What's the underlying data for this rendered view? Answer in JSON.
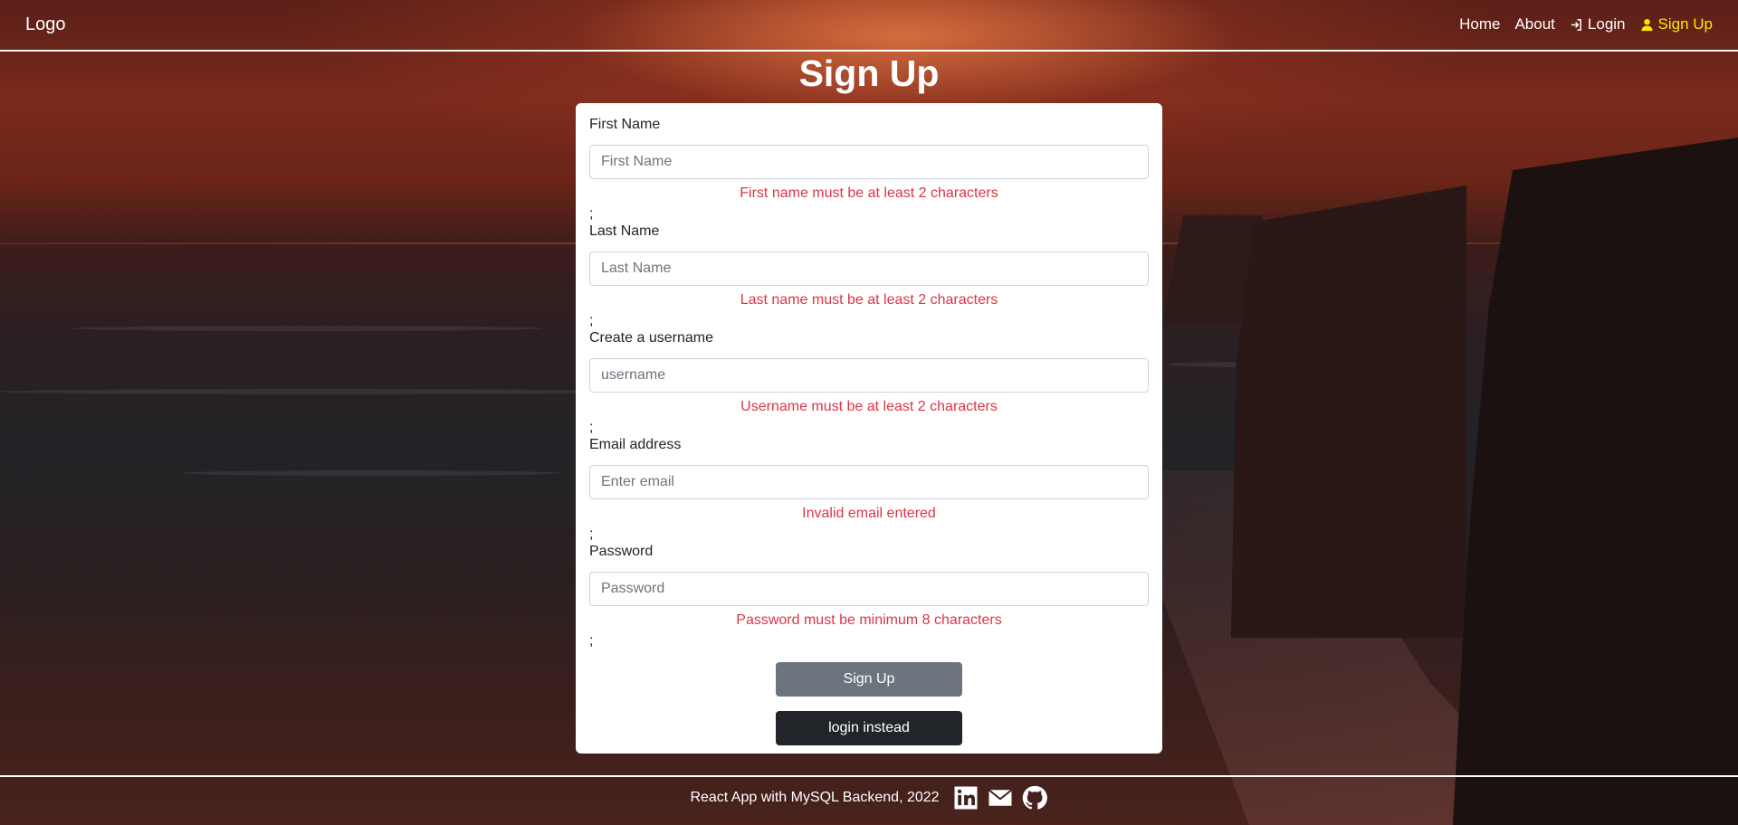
{
  "navbar": {
    "logo": "Logo",
    "links": [
      {
        "label": "Home"
      },
      {
        "label": "About"
      },
      {
        "label": "Login",
        "icon": "login-icon"
      },
      {
        "label": "Sign Up",
        "icon": "user-icon",
        "active": true
      }
    ],
    "active_color": "#ffe600"
  },
  "page_title": "Sign Up",
  "form": {
    "fields": [
      {
        "label": "First Name",
        "placeholder": "First Name",
        "value": "",
        "error": "First name must be at least 2 characters",
        "separator": ";"
      },
      {
        "label": "Last Name",
        "placeholder": "Last Name",
        "value": "",
        "error": "Last name must be at least 2 characters",
        "separator": ";"
      },
      {
        "label": "Create a username",
        "placeholder": "username",
        "value": "",
        "error": "Username must be at least 2 characters",
        "separator": ";"
      },
      {
        "label": "Email address",
        "placeholder": "Enter email",
        "value": "",
        "error": "Invalid email entered",
        "separator": ";"
      },
      {
        "label": "Password",
        "placeholder": "Password",
        "value": "",
        "error": "Password must be minimum 8 characters",
        "separator": ";"
      }
    ],
    "submit_label": "Sign Up",
    "login_label": "login instead",
    "error_color": "#dc3545"
  },
  "footer": {
    "text": "React App with MySQL Backend, 2022",
    "icons": [
      "linkedin-icon",
      "email-icon",
      "github-icon"
    ]
  }
}
